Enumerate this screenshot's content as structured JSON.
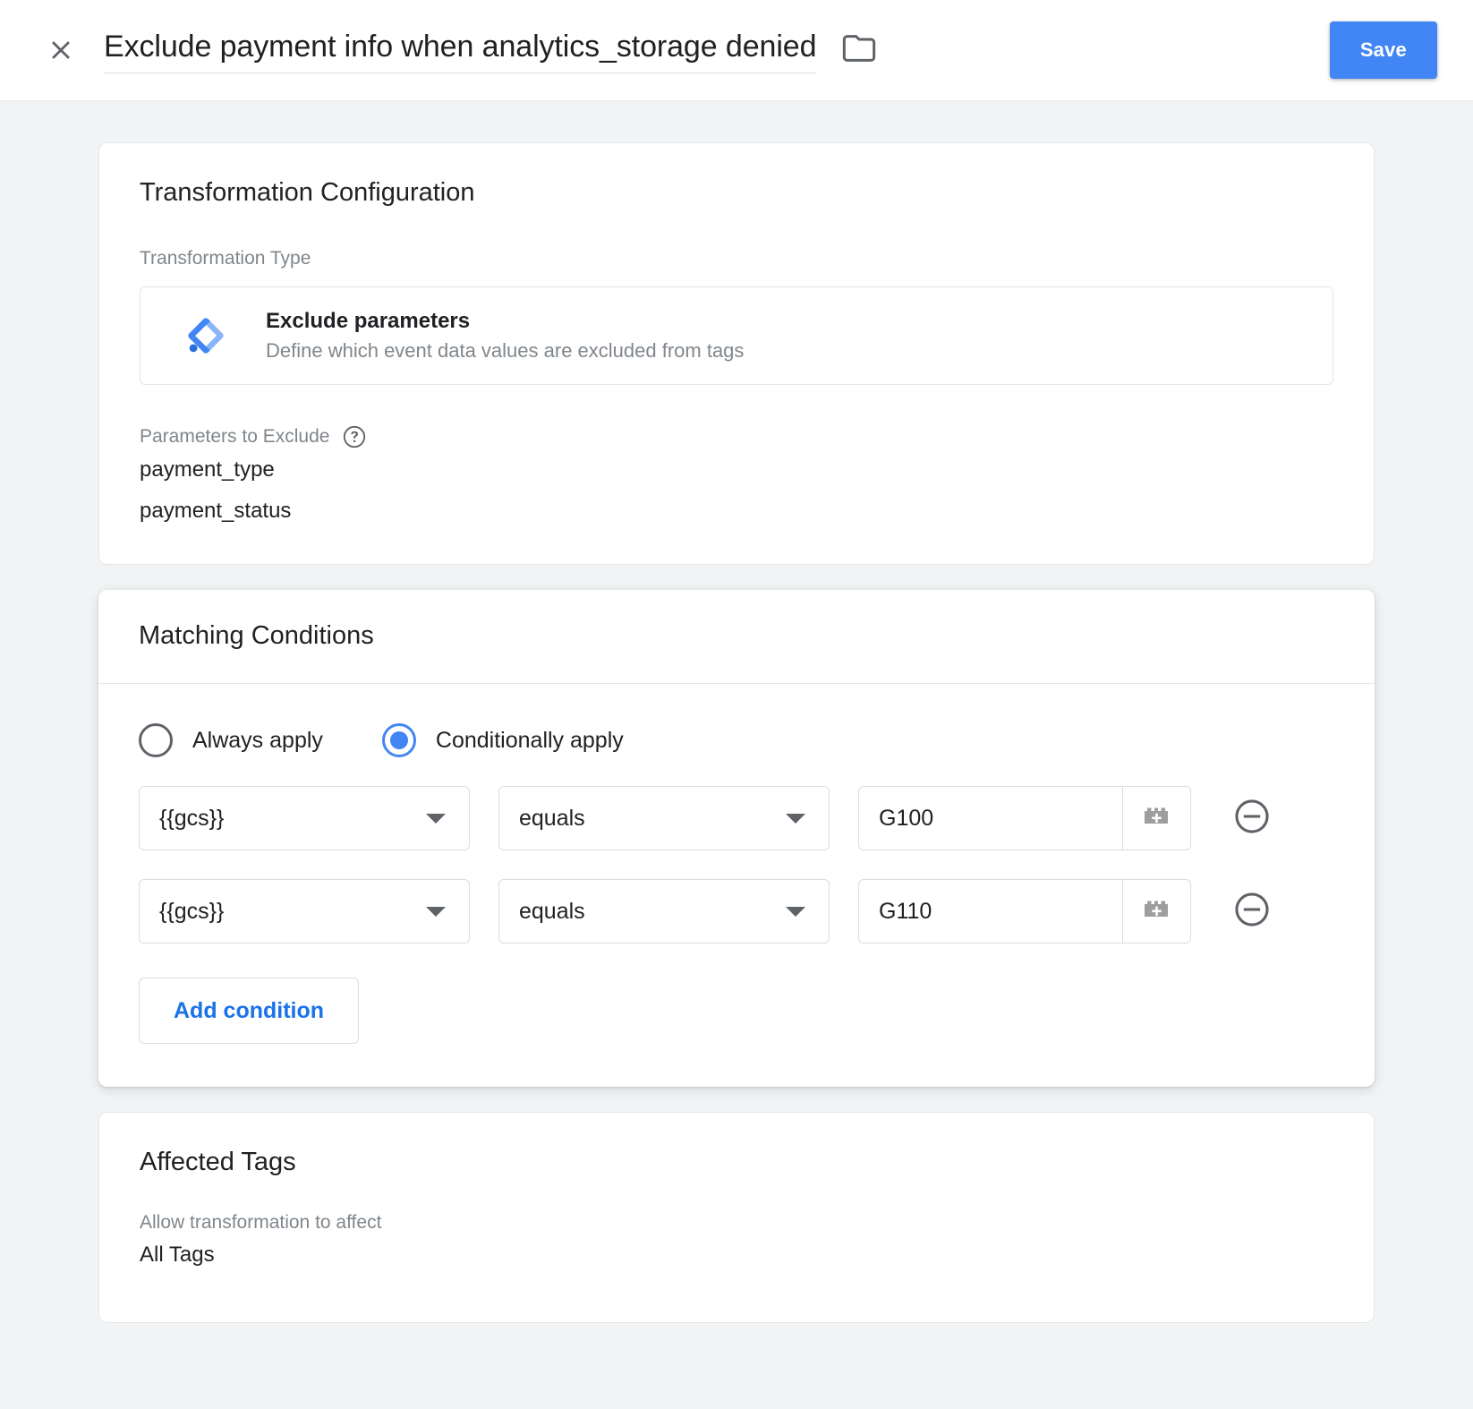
{
  "header": {
    "close_icon": "close-icon",
    "title": "Exclude payment info when analytics_storage denied",
    "folder_icon": "folder-icon",
    "save_label": "Save",
    "accent_color": "#4285f4"
  },
  "transformation_card": {
    "title": "Transformation Configuration",
    "type_label": "Transformation Type",
    "type": {
      "icon": "gtm-diamond-icon",
      "name": "Exclude parameters",
      "description": "Define which event data values are excluded from tags"
    },
    "parameters_label": "Parameters to Exclude",
    "parameters_help_icon": "help-circle-icon",
    "parameters": [
      "payment_type",
      "payment_status"
    ]
  },
  "matching_conditions_card": {
    "title": "Matching Conditions",
    "apply_mode": {
      "options": [
        {
          "label": "Always apply",
          "selected": false
        },
        {
          "label": "Conditionally apply",
          "selected": true
        }
      ]
    },
    "conditions": [
      {
        "variable": "{{gcs}}",
        "operator": "equals",
        "value": "G100",
        "value_placeholder": "",
        "variable_picker_icon": "lego-brick-plus-icon",
        "remove_icon": "minus-circle-icon"
      },
      {
        "variable": "{{gcs}}",
        "operator": "equals",
        "value": "G110",
        "value_placeholder": "",
        "variable_picker_icon": "lego-brick-plus-icon",
        "remove_icon": "minus-circle-icon"
      }
    ],
    "add_condition_label": "Add condition",
    "add_condition_color": "#1a73e8"
  },
  "affected_tags_card": {
    "title": "Affected Tags",
    "allow_label": "Allow transformation to affect",
    "allow_value": "All Tags"
  }
}
